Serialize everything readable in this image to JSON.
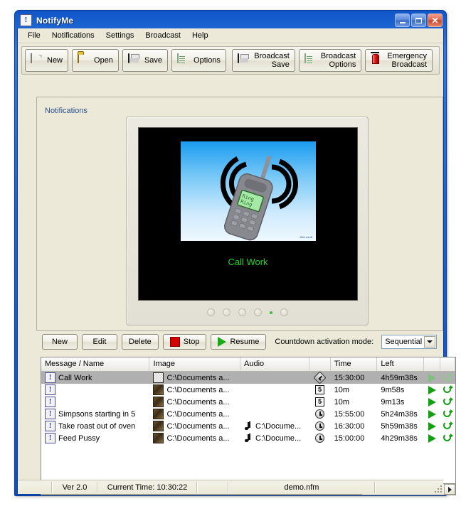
{
  "window": {
    "title": "NotifyMe",
    "app_icon": "exclamation-icon",
    "minimize_label": "Minimize",
    "maximize_label": "Maximize",
    "close_label": "Close"
  },
  "menubar": {
    "items": [
      {
        "label": "File"
      },
      {
        "label": "Notifications"
      },
      {
        "label": "Settings"
      },
      {
        "label": "Broadcast"
      },
      {
        "label": "Help"
      }
    ]
  },
  "toolbar": {
    "buttons": [
      {
        "label": "New",
        "icon": "document-icon"
      },
      {
        "label": "Open",
        "icon": "folder-icon"
      },
      {
        "label": "Save",
        "icon": "floppy-disk-icon"
      },
      {
        "label": "Options",
        "icon": "list-icon"
      },
      {
        "label_line1": "Broadcast",
        "label_line2": "Save",
        "icon": "floppy-disk-icon"
      },
      {
        "label_line1": "Broadcast",
        "label_line2": "Options",
        "icon": "list-icon"
      },
      {
        "label_line1": "Emergency",
        "label_line2": "Broadcast",
        "icon": "siren-icon"
      }
    ]
  },
  "groupbox": {
    "label": "Notifications"
  },
  "preview": {
    "message_text": "Call Work",
    "image_alt": "cellphone-ringing-clipart",
    "clip_credit": "Microsoft",
    "text_color": "#19d819",
    "background_color": "#000000"
  },
  "controls": {
    "new_label": "New",
    "edit_label": "Edit",
    "delete_label": "Delete",
    "stop_label": "Stop",
    "resume_label": "Resume",
    "mode_label": "Countdown activation mode:",
    "mode_value": "Sequential",
    "mode_options": [
      "Sequential"
    ]
  },
  "table": {
    "columns": [
      {
        "label": "Message / Name"
      },
      {
        "label": "Image"
      },
      {
        "label": "Audio"
      },
      {
        "label": ""
      },
      {
        "label": "Time"
      },
      {
        "label": "Left"
      },
      {
        "label": ""
      },
      {
        "label": ""
      }
    ],
    "rows": [
      {
        "name": "Call Work",
        "image": "C:\\Documents a...",
        "audio": "",
        "type_icon": "clock-selected-icon",
        "time": "15:30:00",
        "left": "4h59m38s",
        "selected": true
      },
      {
        "name": "",
        "image": "C:\\Documents a...",
        "audio": "",
        "type_icon": "countdown-5-icon",
        "time": "10m",
        "left": "9m58s",
        "selected": false
      },
      {
        "name": "",
        "image": "C:\\Documents a...",
        "audio": "",
        "type_icon": "countdown-5-icon",
        "time": "10m",
        "left": "9m13s",
        "selected": false
      },
      {
        "name": "Simpsons starting in 5",
        "image": "C:\\Documents a...",
        "audio": "",
        "type_icon": "alarm-clock-icon",
        "time": "15:55:00",
        "left": "5h24m38s",
        "selected": false
      },
      {
        "name": "Take roast out of oven",
        "image": "C:\\Documents a...",
        "audio": "C:\\Docume...",
        "type_icon": "alarm-clock-icon",
        "time": "16:30:00",
        "left": "5h59m38s",
        "selected": false
      },
      {
        "name": "Feed Pussy",
        "image": "C:\\Documents a...",
        "audio": "C:\\Docume...",
        "type_icon": "alarm-clock-icon",
        "time": "15:00:00",
        "left": "4h29m38s",
        "selected": false
      }
    ]
  },
  "statusbar": {
    "version": "Ver 2.0",
    "current_time": "Current Time: 10:30:22",
    "filename": "demo.nfm"
  }
}
